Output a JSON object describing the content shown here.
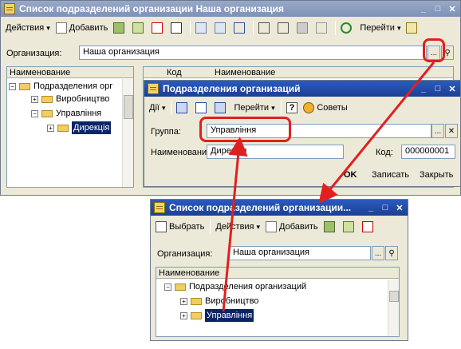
{
  "main_window": {
    "title": "Список подразделений организации Наша организация",
    "toolbar": {
      "actions": "Действия",
      "add": "Добавить",
      "goto": "Перейти"
    },
    "org_label": "Организация:",
    "org_value": "Наша организация",
    "ellipsis": "...",
    "tree_header": "Наименование",
    "list_col_code": "Код",
    "list_col_name": "Наименование",
    "tree": [
      "Подразделения орг",
      "Виробництво",
      "Управління",
      "Дирекція"
    ]
  },
  "dialog": {
    "title": "Подразделения организаций",
    "toolbar": {
      "actions": "Дії",
      "goto": "Перейти",
      "help": "?",
      "tips": "Советы"
    },
    "group_label": "Группа:",
    "group_value": "Управління",
    "name_label": "Наименование:",
    "name_value": "Дирекція",
    "code_label": "Код:",
    "code_value": "000000001",
    "ok": "OK",
    "save": "Записать",
    "close": "Закрыть"
  },
  "second_window": {
    "title": "Список подразделений организации...",
    "toolbar": {
      "choose": "Выбрать",
      "actions": "Действия",
      "add": "Добавить"
    },
    "org_label": "Организация:",
    "org_value": "Наша организация",
    "tree_header": "Наименование",
    "tree": [
      "Подразделения организаций",
      "Виробництво",
      "Управління"
    ]
  },
  "colors": {
    "highlight": "#e02020",
    "title_active": "#1c3f94",
    "title_inactive": "#7e92b8"
  }
}
